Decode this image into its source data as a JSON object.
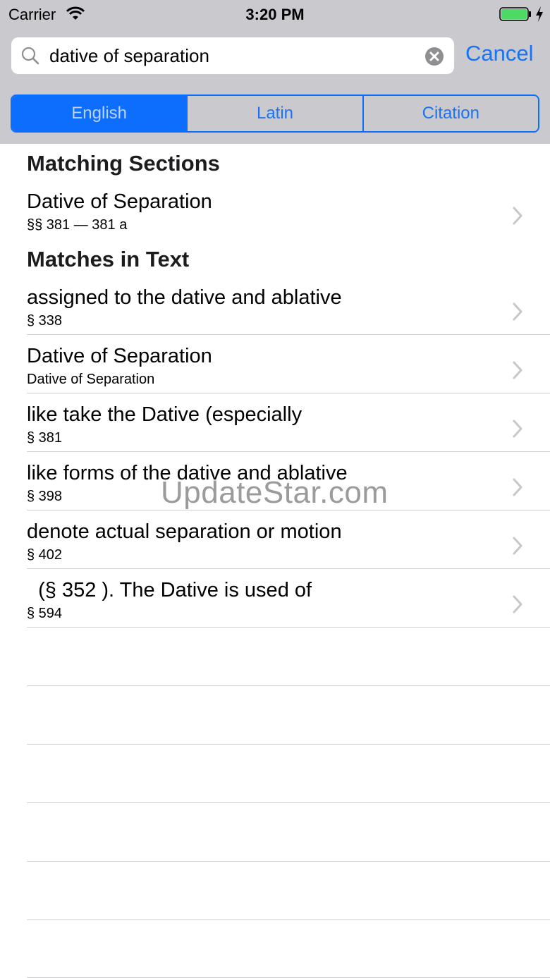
{
  "status_bar": {
    "carrier": "Carrier",
    "time": "3:20 PM"
  },
  "search": {
    "value": "dative of separation",
    "placeholder": "",
    "cancel_label": "Cancel"
  },
  "scope_tabs": [
    {
      "label": "English",
      "selected": true
    },
    {
      "label": "Latin",
      "selected": false
    },
    {
      "label": "Citation",
      "selected": false
    }
  ],
  "sections": {
    "matching_header": "Matching Sections",
    "matching_rows": [
      {
        "title": "Dative of Separation",
        "subtitle": "§§ 381 — 381 a"
      }
    ],
    "text_header": "Matches in Text",
    "text_rows": [
      {
        "title": "assigned to the dative and ablative",
        "subtitle": "§ 338"
      },
      {
        "title": "Dative of Separation",
        "subtitle": "Dative of Separation"
      },
      {
        "title": "like take the Dative (especially",
        "subtitle": "§ 381"
      },
      {
        "title": "like forms of the dative and ablative",
        "subtitle": "§ 398"
      },
      {
        "title": "denote actual separation or motion",
        "subtitle": "§ 402"
      },
      {
        "title": "  (§ 352 ). The Dative is used of",
        "subtitle": "§ 594"
      }
    ]
  },
  "watermark": "UpdateStar.com",
  "colors": {
    "accent": "#0d6efd",
    "header_background": "#c9c9ce",
    "battery": "#4cd964"
  }
}
